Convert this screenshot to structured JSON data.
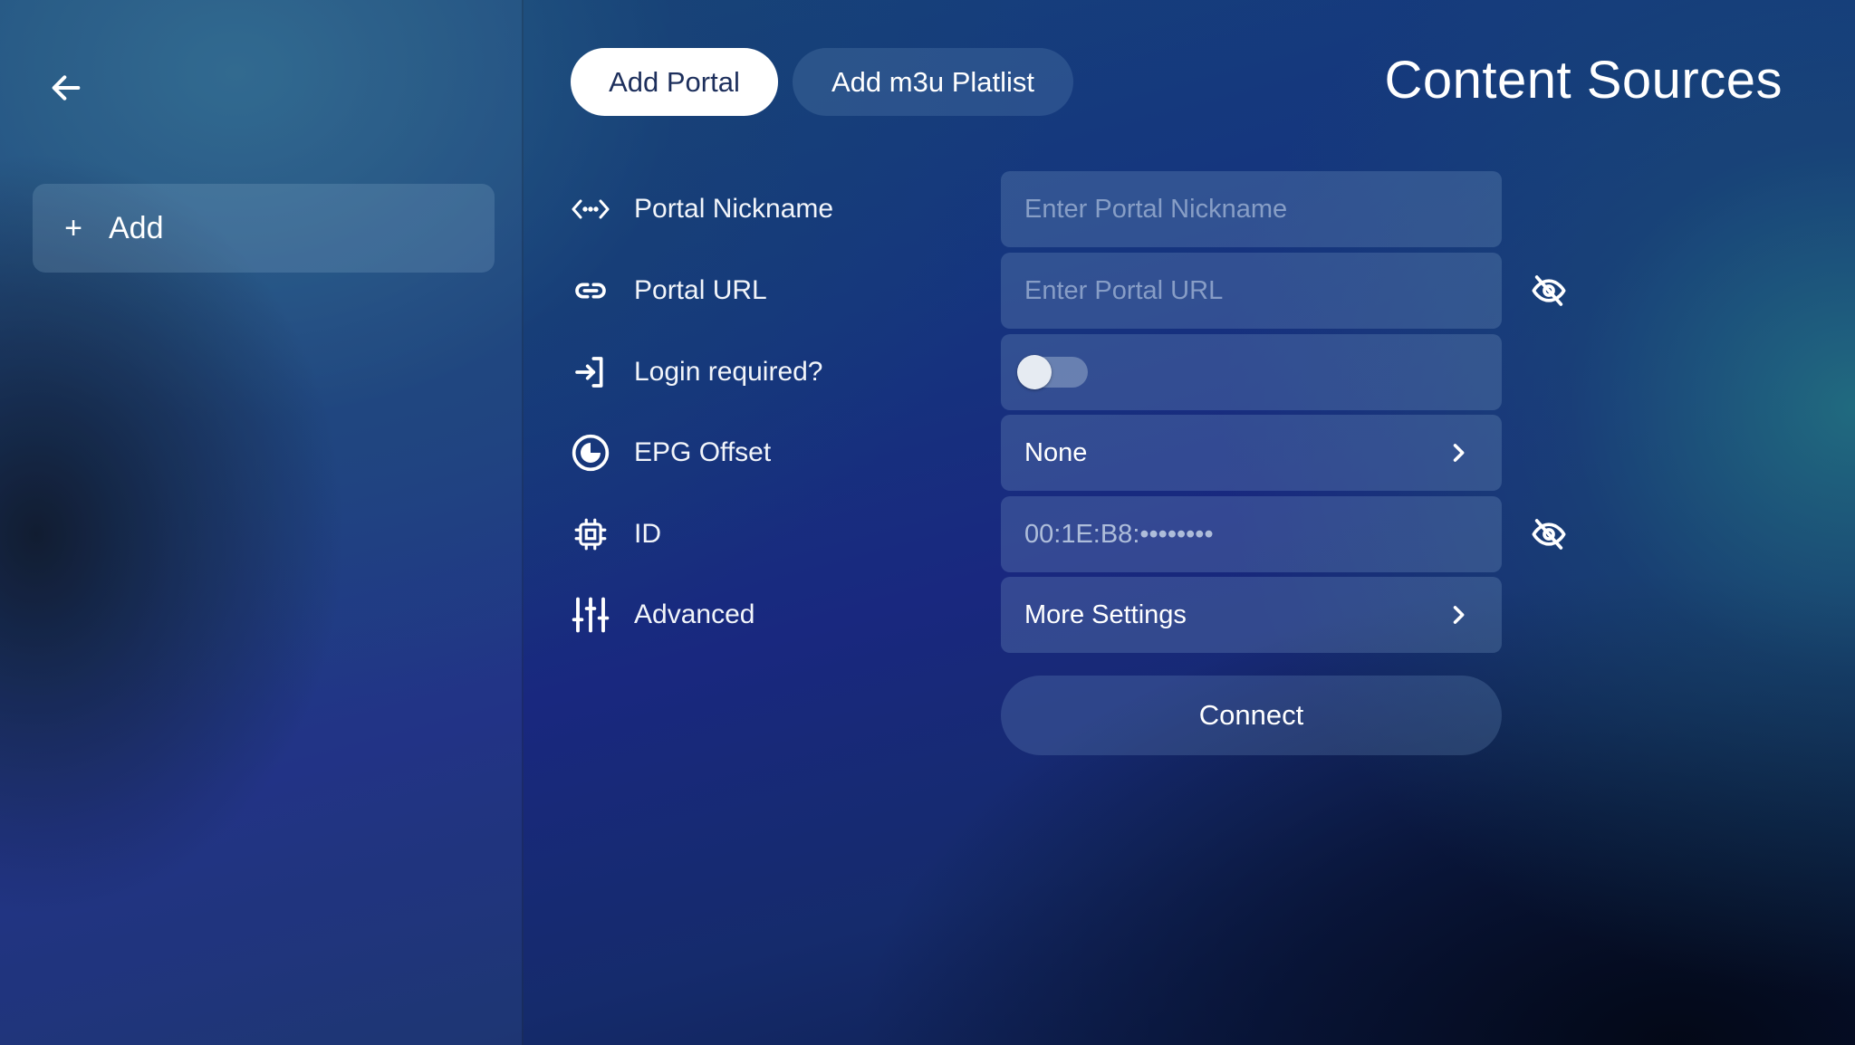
{
  "sidebar": {
    "back_icon": "arrow-left-icon",
    "add_label": "Add",
    "add_symbol": "+"
  },
  "header": {
    "tabs": [
      {
        "label": "Add Portal",
        "active": true
      },
      {
        "label": "Add m3u Platlist",
        "active": false
      }
    ],
    "title": "Content Sources"
  },
  "form": {
    "nickname": {
      "label": "Portal Nickname",
      "placeholder": "Enter Portal Nickname",
      "value": "",
      "icon": "code-brackets-icon"
    },
    "url": {
      "label": "Portal URL",
      "placeholder": "Enter Portal URL",
      "value": "",
      "icon": "link-icon",
      "visibility_icon": "eye-off-icon"
    },
    "login": {
      "label": "Login required?",
      "enabled": false,
      "icon": "login-icon"
    },
    "epg": {
      "label": "EPG Offset",
      "value": "None",
      "icon": "clock-offset-icon"
    },
    "id": {
      "label": "ID",
      "value": "00:1E:B8:••••••••",
      "icon": "chip-icon",
      "visibility_icon": "eye-off-icon"
    },
    "advanced": {
      "label": "Advanced",
      "value": "More Settings",
      "icon": "sliders-icon"
    }
  },
  "connect_label": "Connect",
  "colors": {
    "active_tab_bg": "#ffffff",
    "active_tab_text": "#1d2f5c",
    "field_bg": "rgba(130,165,205,0.26)"
  }
}
